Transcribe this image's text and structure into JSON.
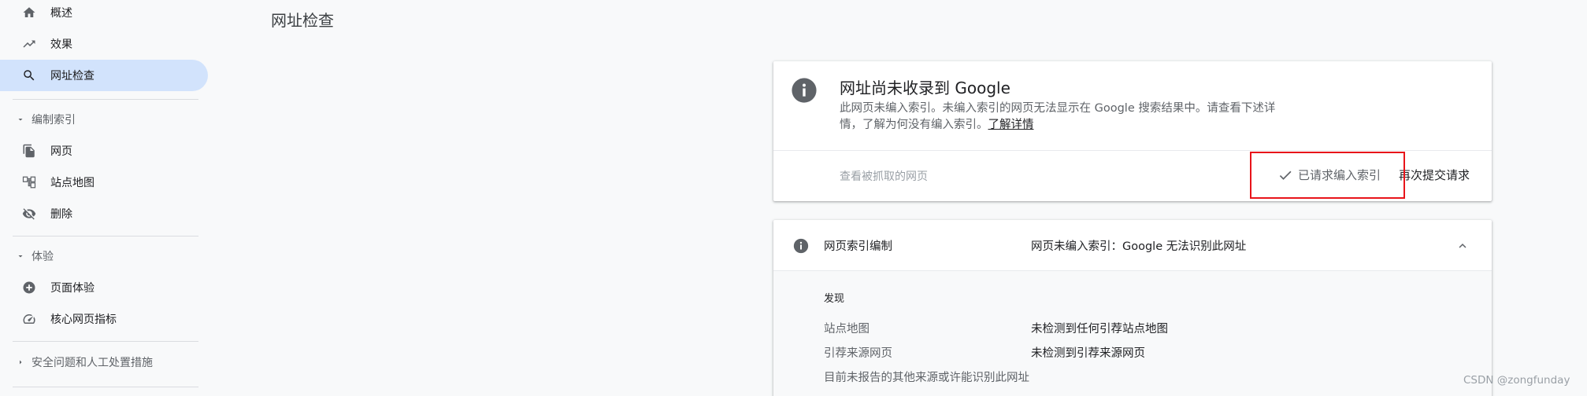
{
  "sidebar": {
    "items": [
      {
        "label": "概述",
        "icon": "home-icon"
      },
      {
        "label": "效果",
        "icon": "trending-up-icon"
      },
      {
        "label": "网址检查",
        "icon": "search-icon",
        "active": true
      }
    ],
    "sections": [
      {
        "label": "编制索引",
        "expanded": true,
        "items": [
          {
            "label": "网页",
            "icon": "pages-icon"
          },
          {
            "label": "站点地图",
            "icon": "sitemap-icon"
          },
          {
            "label": "删除",
            "icon": "eye-off-icon"
          }
        ]
      },
      {
        "label": "体验",
        "expanded": true,
        "items": [
          {
            "label": "页面体验",
            "icon": "add-circle-icon"
          },
          {
            "label": "核心网页指标",
            "icon": "speed-icon"
          }
        ]
      },
      {
        "label": "安全问题和人工处置措施",
        "expanded": false
      }
    ]
  },
  "main": {
    "page_title": "网址检查",
    "status_card": {
      "title": "网址尚未收录到 Google",
      "description": "此网页未编入索引。未编入索引的网页无法显示在 Google 搜索结果中。请查看下述详情，了解为何没有编入索引。",
      "learn_more": "了解详情",
      "view_crawled": "查看被抓取的网页",
      "requested_label": "已请求编入索引",
      "resubmit_label": "再次提交请求"
    },
    "indexing_card": {
      "label": "网页索引编制",
      "value": "网页未编入索引：Google 无法识别此网址",
      "discovery_title": "发现",
      "rows": [
        {
          "label": "站点地图",
          "value": "未检测到任何引荐站点地图"
        },
        {
          "label": "引荐来源网页",
          "value": "未检测到引荐来源网页"
        },
        {
          "label": "目前未报告的其他来源或许能识别此网址",
          "value": ""
        }
      ]
    }
  },
  "watermark": "CSDN @zongfunday",
  "colors": {
    "active_nav": "#d2e3fc",
    "highlight_box": "#e8141a",
    "info_icon": "#5f6368"
  }
}
